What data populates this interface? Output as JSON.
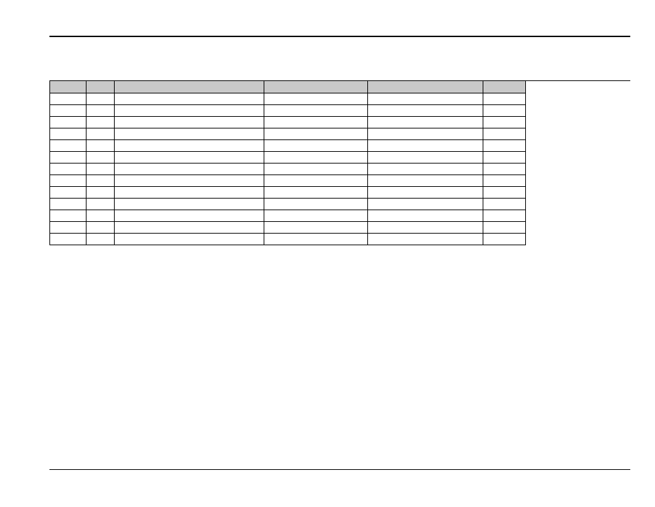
{
  "table": {
    "headers": [
      "",
      "",
      "",
      "",
      "",
      ""
    ],
    "rows": [
      [
        "",
        "",
        "",
        "",
        "",
        ""
      ],
      [
        "",
        "",
        "",
        "",
        "",
        ""
      ],
      [
        "",
        "",
        "",
        "",
        "",
        ""
      ],
      [
        "",
        "",
        "",
        "",
        "",
        ""
      ],
      [
        "",
        "",
        "",
        "",
        "",
        ""
      ],
      [
        "",
        "",
        "",
        "",
        "",
        ""
      ],
      [
        "",
        "",
        "",
        "",
        "",
        ""
      ],
      [
        "",
        "",
        "",
        "",
        "",
        ""
      ],
      [
        "",
        "",
        "",
        "",
        "",
        ""
      ],
      [
        "",
        "",
        "",
        "",
        "",
        ""
      ],
      [
        "",
        "",
        "",
        "",
        "",
        ""
      ],
      [
        "",
        "",
        "",
        "",
        "",
        ""
      ],
      [
        "",
        "",
        "",
        "",
        "",
        ""
      ]
    ]
  }
}
